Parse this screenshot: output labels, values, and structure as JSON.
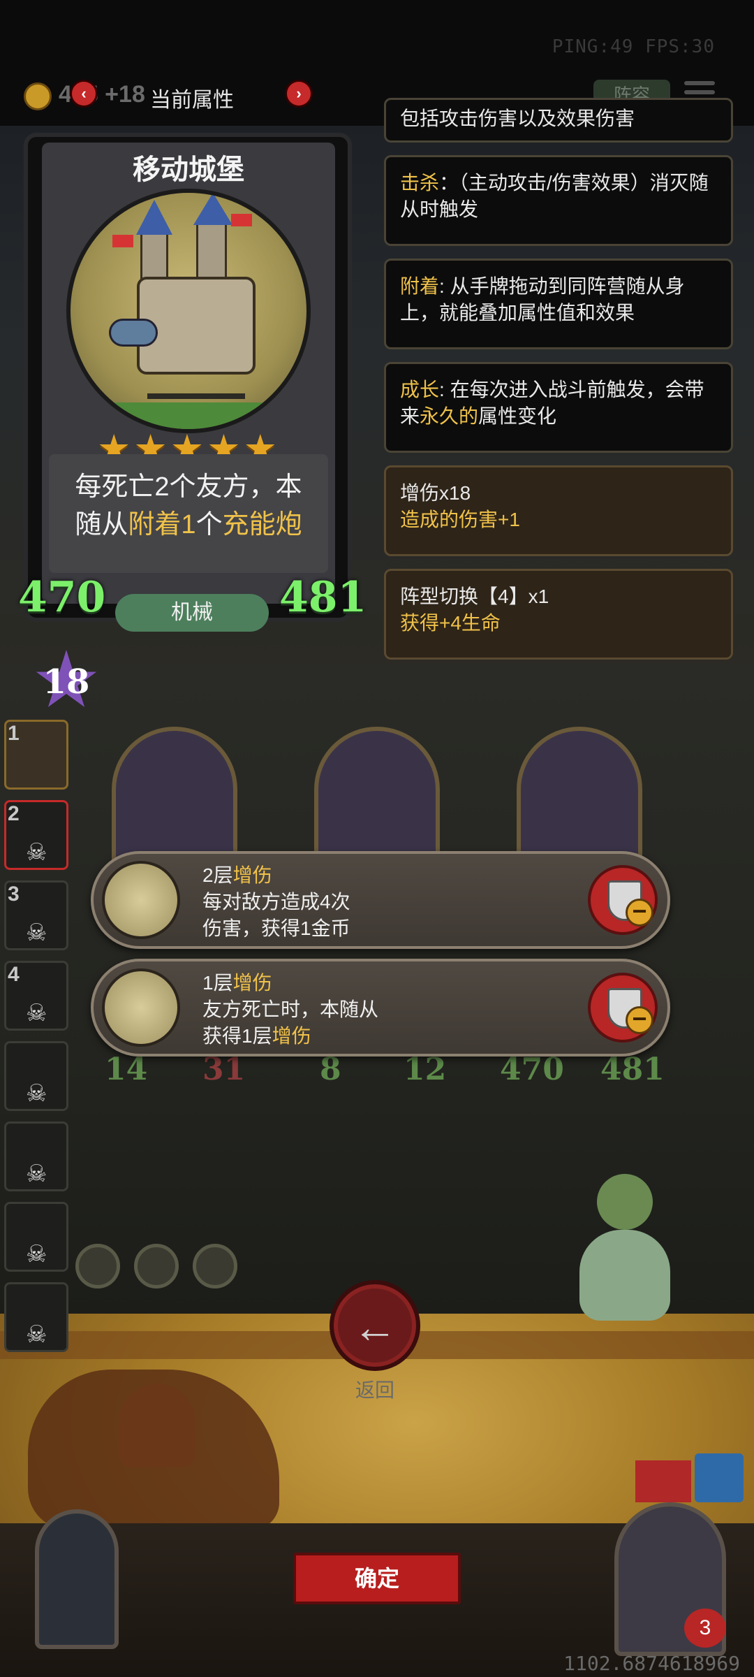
{
  "status": {
    "ping": "PING:49 FPS:30",
    "gold": "405 +18",
    "coords": "1102.6874618969"
  },
  "header": {
    "title": "当前属性",
    "prev_icon": "chevron-left-icon",
    "prev_label": "‹",
    "next_icon": "chevron-right-icon",
    "next_label": "›",
    "lineup_label": "阵容",
    "menu_icon": "hamburger-menu-icon"
  },
  "card": {
    "name": "移动城堡",
    "stars": "★★★★★",
    "desc_part1": "每死亡2个友方，本",
    "desc_part2": "随从",
    "desc_hl1": "附着1",
    "desc_mid": "个",
    "desc_hl2": "充能炮",
    "attack": "470",
    "health": "481",
    "tribe": "机械",
    "level": "18"
  },
  "keywords": [
    {
      "key": "",
      "text": "包括攻击伤害以及效果伤害"
    },
    {
      "key": "击杀",
      "text": "：（主动攻击/伤害效果）消灭随从时触发"
    },
    {
      "key": "附着",
      "text": ": 从手牌拖动到同阵营随从身上，就能叠加属性值和效果"
    },
    {
      "key": "成长",
      "text_before": ": 在每次进入战斗前触发，会带来",
      "hl": "永久的",
      "text_after": "属性变化"
    }
  ],
  "effects": [
    {
      "line1": "增伤x18",
      "line2": "造成的伤害+1"
    },
    {
      "line1": "阵型切换【4】x1",
      "line2": "获得+4生命"
    }
  ],
  "sidebar": {
    "slots": [
      "1",
      "2",
      "3",
      "4",
      "",
      "",
      "",
      ""
    ],
    "skull_icon": "☠"
  },
  "board": {
    "stats": [
      {
        "atk": "14",
        "hp": "31"
      },
      {
        "atk": "8",
        "hp": "12"
      },
      {
        "atk": "470",
        "hp": "481"
      }
    ]
  },
  "buffs": [
    {
      "level": "2层",
      "name": "增伤",
      "line2": "每对敌方造成4次",
      "line3": "伤害，获得1金币",
      "icon": "castle-icon"
    },
    {
      "level": "1层",
      "name": "增伤",
      "line2": "友方死亡时，本随从",
      "line3_before": "获得1层",
      "line3_hl": "增伤",
      "icon": "slingshot-icon"
    }
  ],
  "buttons": {
    "back_label": "返回",
    "back_arrow": "←",
    "confirm_label": "确定",
    "remove_minus": "−"
  },
  "lives": "3"
}
